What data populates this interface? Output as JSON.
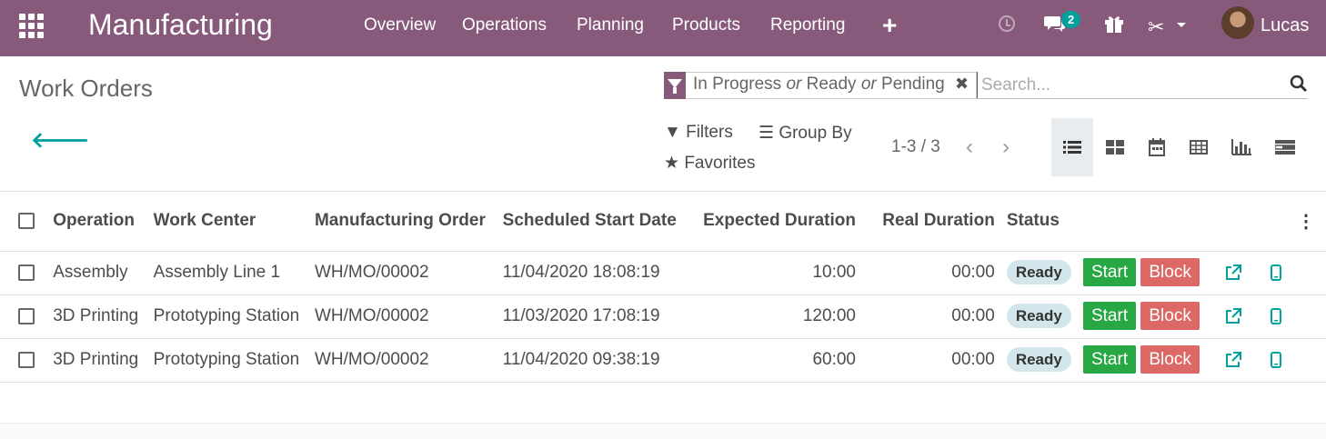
{
  "topbar": {
    "app_title": "Manufacturing",
    "nav": [
      "Overview",
      "Operations",
      "Planning",
      "Products",
      "Reporting"
    ],
    "chat_badge": "2",
    "user_name": "Lucas",
    "bg_color": "#875a7b"
  },
  "control_panel": {
    "page_title": "Work Orders",
    "facet": {
      "part1": "In Progress",
      "or1": "or",
      "part2": "Ready",
      "or2": "or",
      "part3": "Pending",
      "remove": "✖"
    },
    "search_placeholder": "Search...",
    "filters_label": "Filters",
    "groupby_label": "Group By",
    "favorites_label": "Favorites",
    "pager": "1-3 / 3",
    "views": [
      "list-icon",
      "kanban-icon",
      "calendar-icon",
      "pivot-icon",
      "graph-icon",
      "gantt-icon"
    ]
  },
  "table": {
    "columns": [
      "Operation",
      "Work Center",
      "Manufacturing Order",
      "Scheduled Start Date",
      "Expected Duration",
      "Real Duration",
      "Status"
    ],
    "rows": [
      {
        "operation": "Assembly",
        "work_center": "Assembly Line 1",
        "mo": "WH/MO/00002",
        "start": "11/04/2020 18:08:19",
        "expected": "10:00",
        "real": "00:00",
        "status": "Ready"
      },
      {
        "operation": "3D Printing",
        "work_center": "Prototyping Station",
        "mo": "WH/MO/00002",
        "start": "11/03/2020 17:08:19",
        "expected": "120:00",
        "real": "00:00",
        "status": "Ready"
      },
      {
        "operation": "3D Printing",
        "work_center": "Prototyping Station",
        "mo": "WH/MO/00002",
        "start": "11/04/2020 09:38:19",
        "expected": "60:00",
        "real": "00:00",
        "status": "Ready"
      }
    ],
    "start_label": "Start",
    "block_label": "Block"
  },
  "colors": {
    "accent": "#00a09d",
    "start": "#28a745",
    "block": "#dc6965",
    "status_badge": "#d3e6ec"
  }
}
